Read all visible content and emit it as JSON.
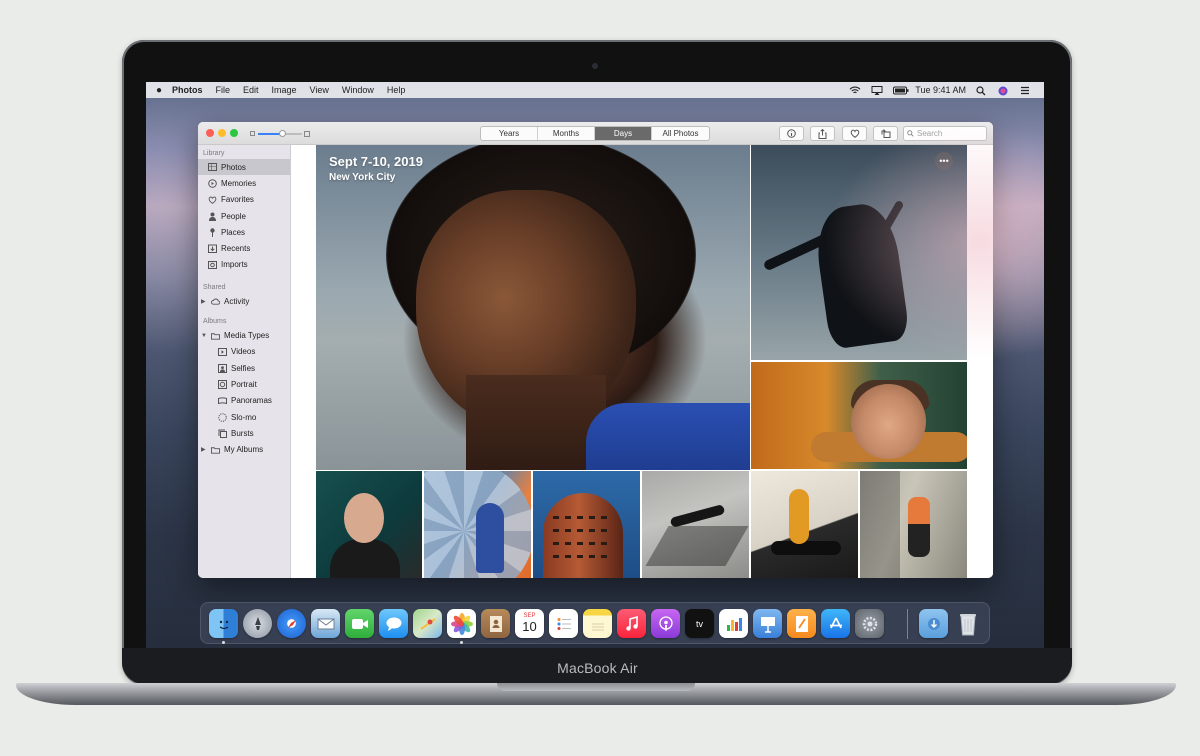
{
  "device": {
    "brand_label": "MacBook Air"
  },
  "menubar": {
    "app_name": "Photos",
    "menus": [
      "File",
      "Edit",
      "Image",
      "View",
      "Window",
      "Help"
    ],
    "clock": "Tue 9:41 AM",
    "status_icons": [
      "wifi-icon",
      "airplay-icon",
      "battery-icon",
      "spotlight-icon",
      "siri-icon",
      "control-list-icon"
    ]
  },
  "toolbar": {
    "segments": [
      "Years",
      "Months",
      "Days",
      "All Photos"
    ],
    "active_segment": "Days",
    "zoom_level": 0.55,
    "buttons": [
      "info-icon",
      "share-icon",
      "heart-icon",
      "rotate-icon"
    ],
    "search_placeholder": "Search"
  },
  "sidebar": {
    "sections": [
      {
        "title": "Library",
        "items": [
          {
            "label": "Photos",
            "icon": "photos-icon",
            "selected": true
          },
          {
            "label": "Memories",
            "icon": "memories-icon"
          },
          {
            "label": "Favorites",
            "icon": "heart-icon"
          },
          {
            "label": "People",
            "icon": "person-icon"
          },
          {
            "label": "Places",
            "icon": "pin-icon"
          },
          {
            "label": "Recents",
            "icon": "recents-icon"
          },
          {
            "label": "Imports",
            "icon": "imports-icon"
          }
        ]
      },
      {
        "title": "Shared",
        "items": [
          {
            "label": "Activity",
            "icon": "cloud-icon",
            "disclosure": true
          }
        ]
      },
      {
        "title": "Albums",
        "items": [
          {
            "label": "Media Types",
            "icon": "folder-icon",
            "disclosure": true,
            "expanded": true
          },
          {
            "label": "Videos",
            "icon": "video-icon",
            "sub": true
          },
          {
            "label": "Selfies",
            "icon": "selfie-icon",
            "sub": true
          },
          {
            "label": "Portrait",
            "icon": "portrait-icon",
            "sub": true
          },
          {
            "label": "Panoramas",
            "icon": "panorama-icon",
            "sub": true
          },
          {
            "label": "Slo-mo",
            "icon": "slomo-icon",
            "sub": true
          },
          {
            "label": "Bursts",
            "icon": "bursts-icon",
            "sub": true
          },
          {
            "label": "My Albums",
            "icon": "folder-icon",
            "disclosure": true
          }
        ]
      }
    ]
  },
  "day_group": {
    "date": "Sept 7-10, 2019",
    "location": "New York City"
  },
  "dock": {
    "apps": [
      "finder-icon",
      "launchpad-icon",
      "safari-icon",
      "mail-icon",
      "facetime-icon",
      "messages-icon",
      "maps-icon",
      "photos-icon",
      "contacts-icon",
      "calendar-icon",
      "reminders-icon",
      "notes-icon",
      "music-icon",
      "podcasts-icon",
      "tv-icon",
      "numbers-icon",
      "keynote-icon",
      "pages-icon",
      "app-store-icon",
      "system-preferences-icon",
      "downloads-folder-icon",
      "trash-icon"
    ],
    "calendar": {
      "month": "SEP",
      "day": "10"
    },
    "tv_label": "tv"
  }
}
